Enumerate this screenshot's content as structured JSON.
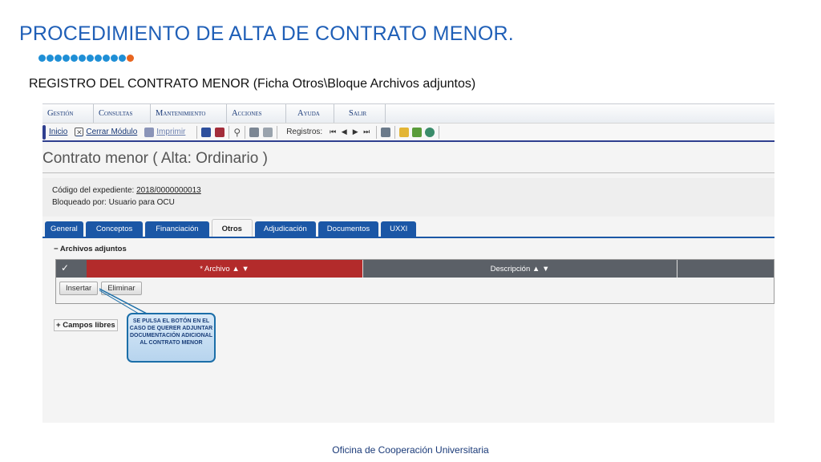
{
  "slide": {
    "title": "PROCEDIMIENTO DE ALTA DE CONTRATO MENOR.",
    "subtitle": "REGISTRO DEL CONTRATO MENOR (Ficha Otros\\Bloque Archivos adjuntos)",
    "footer": "Oficina de Cooperación Universitaria"
  },
  "menubar": {
    "items": [
      "Gestión",
      "Consultas",
      "Mantenimiento",
      "Acciones",
      "Ayuda",
      "Salir"
    ]
  },
  "toolbar": {
    "inicio": "Inicio",
    "cerrar_modulo": "Cerrar Módulo",
    "imprimir": "Imprimir",
    "registros_label": "Registros:"
  },
  "page": {
    "title": "Contrato menor ( Alta: Ordinario )",
    "expediente_label": "Código del expediente:",
    "expediente_value": "2018/0000000013",
    "bloqueado_label": "Bloqueado por:",
    "bloqueado_value": "Usuario para OCU"
  },
  "tabs": [
    {
      "label": "General",
      "active": false
    },
    {
      "label": "Conceptos",
      "active": false
    },
    {
      "label": "Financiación",
      "active": false
    },
    {
      "label": "Otros",
      "active": true
    },
    {
      "label": "Adjudicación",
      "active": false
    },
    {
      "label": "Documentos",
      "active": false
    },
    {
      "label": "UXXI",
      "active": false
    }
  ],
  "archivos": {
    "section_label": "Archivos adjuntos",
    "col_archivo": "* Archivo",
    "col_descripcion": "Descripción",
    "insertar": "Insertar",
    "eliminar": "Eliminar"
  },
  "campos_libres": "Campos libres",
  "callout": {
    "text": "SE PULSA EL BOTÓN EN EL CASO DE QUERER ADJUNTAR DOCUMENTACIÓN ADICIONAL AL CONTRATO MENOR"
  },
  "colors": {
    "title_blue": "#1f5fb7",
    "tab_blue": "#1b57a6",
    "header_red": "#b32b2b",
    "header_gray": "#5b6067",
    "dots": [
      "#1f8fd6",
      "#1f8fd6",
      "#1f8fd6",
      "#1f8fd6",
      "#1f8fd6",
      "#1f8fd6",
      "#1f8fd6",
      "#1f8fd6",
      "#1f8fd6",
      "#1f8fd6",
      "#1f8fd6",
      "#e8651f"
    ]
  }
}
